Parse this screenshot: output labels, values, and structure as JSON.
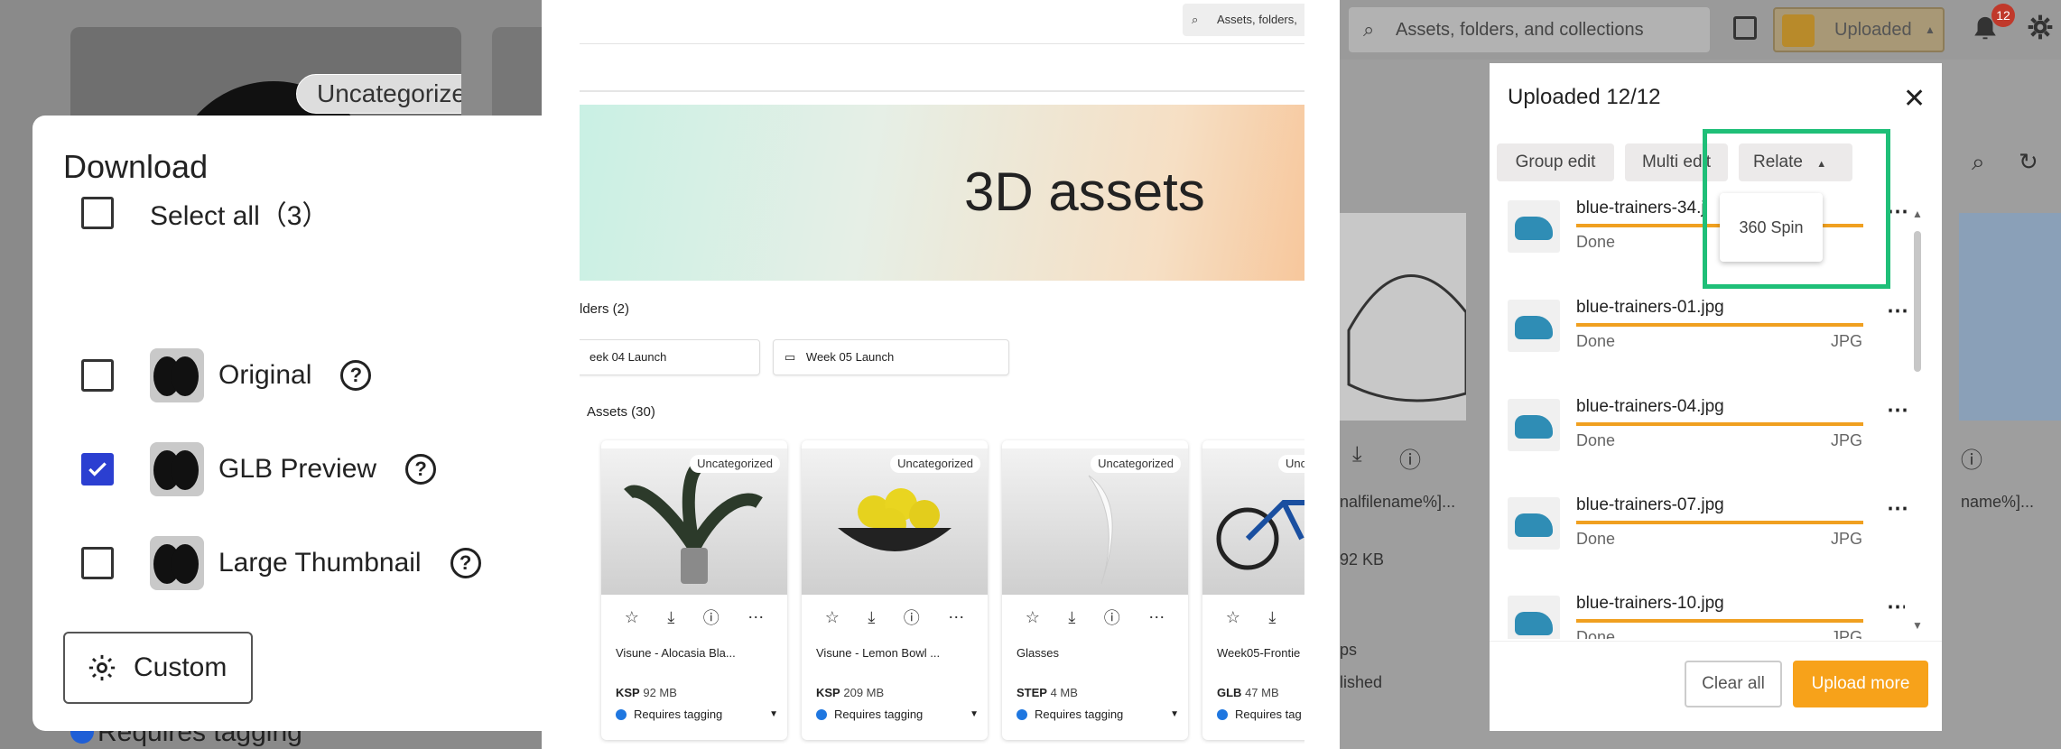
{
  "download_panel": {
    "bg_chip": "Uncategorized",
    "title": "Download",
    "select_all": "Select all（3）",
    "options": [
      {
        "label": "Original",
        "checked": false
      },
      {
        "label": "GLB Preview",
        "checked": true
      },
      {
        "label": "Large Thumbnail",
        "checked": false
      }
    ],
    "custom_button": "Custom",
    "bottom_status": "Requires tagging",
    "colors": {
      "accent": "#2b3fd1"
    }
  },
  "library_panel": {
    "search_placeholder": "Assets, folders,",
    "banner_title": "3D assets",
    "folders_heading": "lders (2)",
    "folders": [
      "eek 04 Launch",
      "Week 05 Launch"
    ],
    "assets_heading": "Assets (30)",
    "assets": [
      {
        "chip": "Uncategorized",
        "name": "Visune - Alocasia Bla...",
        "format": "KSP",
        "size": "92 MB",
        "status": "Requires tagging"
      },
      {
        "chip": "Uncategorized",
        "name": "Visune - Lemon Bowl ...",
        "format": "KSP",
        "size": "209 MB",
        "status": "Requires tagging"
      },
      {
        "chip": "Uncategorized",
        "name": "Glasses",
        "format": "STEP",
        "size": "4 MB",
        "status": "Requires tagging"
      },
      {
        "chip": "Unc",
        "name": "Week05-Frontie",
        "format": "GLB",
        "size": "47 MB",
        "status": "Requires tag"
      }
    ]
  },
  "upload_panel": {
    "search_placeholder": "Assets, folders, and collections",
    "uploaded_button": "Uploaded",
    "notification_count": "12",
    "bg_text": [
      "nalfilename%]...",
      "name%]...",
      "92 KB",
      "ps",
      "lished"
    ],
    "modal_title": "Uploaded 12/12",
    "toolbar": {
      "group_edit": "Group edit",
      "multi_edit": "Multi edit",
      "relate": "Relate"
    },
    "relate_menu": [
      "360 Spin"
    ],
    "files": [
      {
        "name": "blue-trainers-34.j",
        "status": "Done",
        "type": ""
      },
      {
        "name": "blue-trainers-01.jpg",
        "status": "Done",
        "type": "JPG"
      },
      {
        "name": "blue-trainers-04.jpg",
        "status": "Done",
        "type": "JPG"
      },
      {
        "name": "blue-trainers-07.jpg",
        "status": "Done",
        "type": "JPG"
      },
      {
        "name": "blue-trainers-10.jpg",
        "status": "Done",
        "type": "JPG"
      }
    ],
    "clear_all": "Clear  all",
    "upload_more": "Upload more",
    "colors": {
      "primary": "#f7a21a",
      "highlight": "#1fbf78"
    }
  }
}
